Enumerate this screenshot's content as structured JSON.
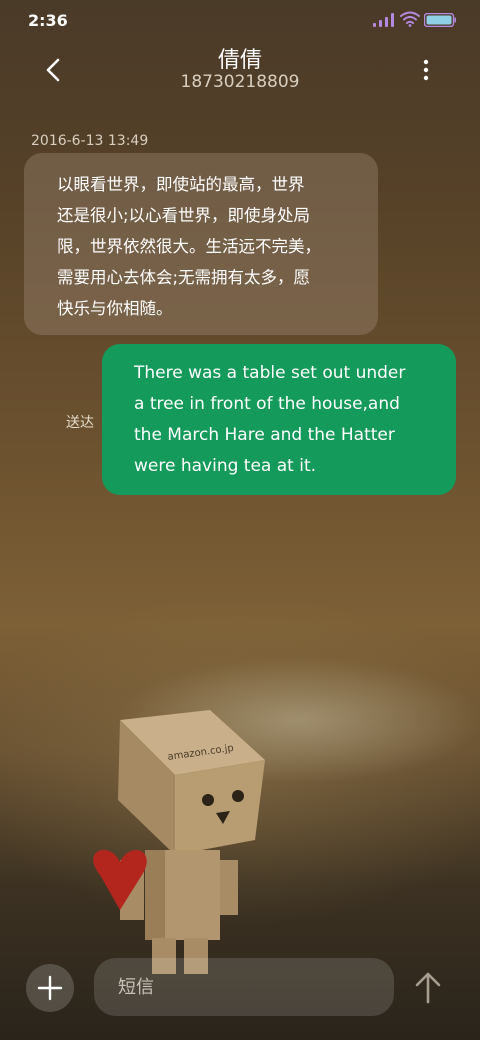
{
  "status_bar": {
    "time": "2:36",
    "icons": [
      "signal-icon",
      "wifi-icon",
      "battery-icon"
    ],
    "accent_color": "#a57cd6"
  },
  "header": {
    "contact_name": "倩倩",
    "contact_number": "18730218809",
    "back_icon": "chevron-left-icon",
    "more_icon": "more-vertical-icon"
  },
  "conversation": {
    "timestamp": "2016-6-13 13:49",
    "messages": [
      {
        "direction": "incoming",
        "lines": [
          "以眼看世界，即使站的最高，世界",
          "还是很小;以心看世界，即使身处局",
          "限，世界依然很大。生活远不完美，",
          "需要用心去体会;无需拥有太多，愿",
          "快乐与你相随。"
        ]
      },
      {
        "direction": "outgoing",
        "status": "送达",
        "color": "#149a5a",
        "lines": [
          "There was a table set out under",
          "a tree in front of the house,and",
          "the March Hare and the Hatter",
          "were having tea at it."
        ]
      }
    ]
  },
  "background": {
    "box_label": "amazon.co.jp"
  },
  "input_bar": {
    "placeholder": "短信",
    "add_icon": "plus-icon",
    "send_icon": "arrow-up-icon"
  }
}
